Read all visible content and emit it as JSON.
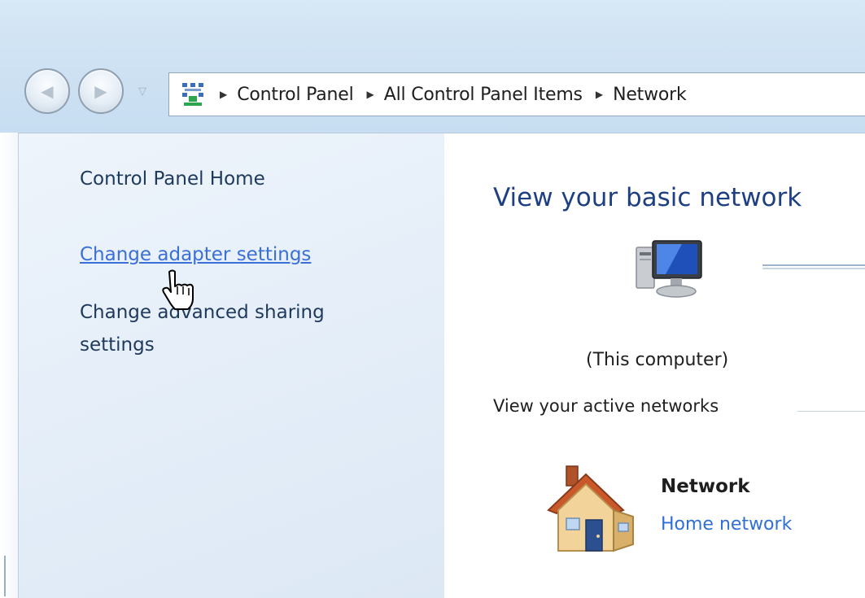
{
  "address_bar": {
    "breadcrumbs": [
      "Control Panel",
      "All Control Panel Items",
      "Network"
    ]
  },
  "left_pane": {
    "home_label": "Control Panel Home",
    "links": [
      {
        "label": "Change adapter settings"
      },
      {
        "label": "Change advanced sharing settings"
      }
    ]
  },
  "main": {
    "title": "View your basic network",
    "this_computer_label": "(This computer)",
    "active_networks_label": "View your active networks",
    "network": {
      "name": "Network",
      "type": "Home network"
    }
  },
  "icons": {
    "back": "back-arrow-icon",
    "forward": "forward-arrow-icon",
    "address": "control-panel-icon",
    "computer": "computer-icon",
    "network": "home-network-icon",
    "cursor": "hand-cursor-icon"
  },
  "colors": {
    "link": "#3a6fd8",
    "title": "#1e3f82",
    "nav_text": "#1e395b",
    "pane_bg": "#e3edf8"
  }
}
